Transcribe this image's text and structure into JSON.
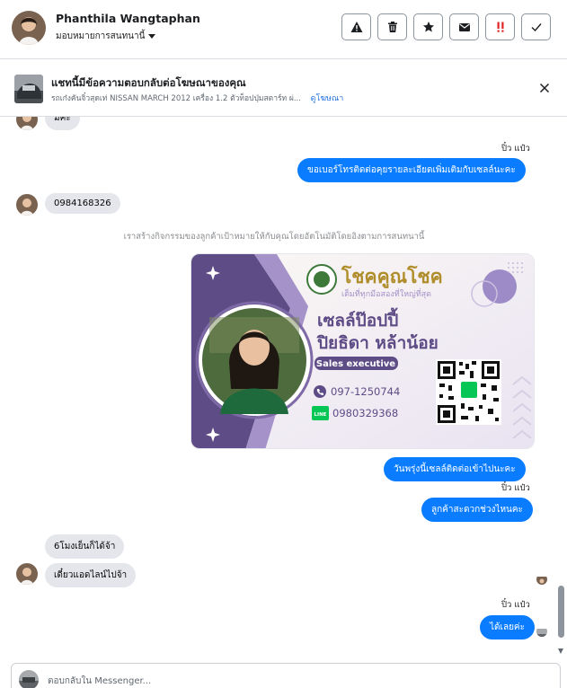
{
  "header": {
    "name": "Phanthila Wangtaphan",
    "assign_label": "มอบหมายการสนทนานี้"
  },
  "ad": {
    "title": "แชทนี้มีข้อความตอบกลับต่อโฆษณาของคุณ",
    "subtitle": "รถเก๋งคันจิ๋วสุดเท่ NISSAN MARCH 2012 เครื่อง 1.2 ตัวท็อปปุ่มสตาร์ท ผ่...",
    "view_ad": "ดูโฆษณา"
  },
  "messages": {
    "m0": "มีค่ะ",
    "seen1": "ปิ๋ว แป๋ว",
    "out1": "ขอเบอร์โทรติดต่อคุยรายละเอียดเพิ่มเติมกับเซลล์นะคะ",
    "in1": "0984168326",
    "system": "เราสร้างกิจกรรมของลูกค้าเป้าหมายให้กับคุณโดยอัตโนมัติโดยอิงตามการสนทนานี้",
    "out2": "วันพรุ่งนี้เซลล์ติดต่อเข้าไปนะคะ",
    "seen2": "ปิ๋ว แป๋ว",
    "out3": "ลูกค้าสะดวกช่วงไหนคะ",
    "in2": "6โมงเย็นก็ได้จ้า",
    "in3": "เดี๋ยวแอดไลน์ไปจ้า",
    "seen3": "ปิ๋ว แป๋ว",
    "out4": "ได้เลยค่ะ"
  },
  "card": {
    "brand": "โชคคูณโชค",
    "tagline": "เต็มที่ทุกมือสองที่ใหญ่ที่สุด",
    "nickname": "เซลล์ป๊อปปี้",
    "fullname": "ปิยธิดา หล้าน้อย",
    "role": "Sales executive",
    "phone": "097-1250744",
    "line_label": "LINE",
    "line_id": "0980329368",
    "colors": {
      "purple": "#6b5b95",
      "light_purple": "#a592c9",
      "pink": "#f1e7f3",
      "gold": "#b08d2b"
    }
  },
  "reply": {
    "placeholder": "ตอบกลับใน Messenger..."
  },
  "icons": [
    "warning-icon",
    "trash-icon",
    "star-icon",
    "envelope-icon",
    "exclamation-icon",
    "check-icon",
    "close-icon",
    "phone-icon",
    "line-icon"
  ]
}
